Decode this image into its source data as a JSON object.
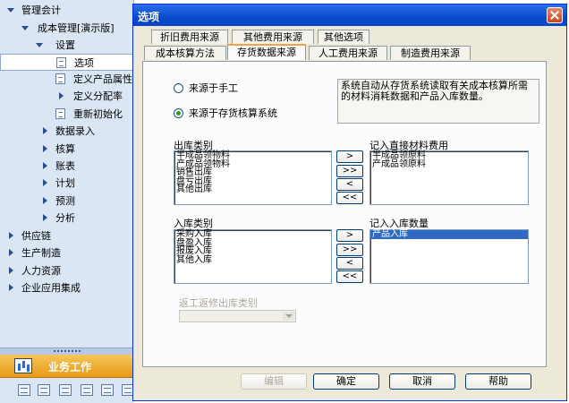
{
  "nav": {
    "items": [
      {
        "label": "管理会计",
        "expander": "down"
      },
      {
        "label": "成本管理[演示版]",
        "expander": "down"
      },
      {
        "label": "设置",
        "expander": "down"
      },
      {
        "label": "选项",
        "icon": "doc-icon",
        "selected": true
      },
      {
        "label": "定义产品属性",
        "icon": "doc-icon"
      },
      {
        "label": "定义分配率",
        "expander": "right"
      },
      {
        "label": "重新初始化",
        "icon": "doc-icon"
      },
      {
        "label": "数据录入",
        "expander": "right"
      },
      {
        "label": "核算",
        "expander": "right"
      },
      {
        "label": "账表",
        "expander": "right"
      },
      {
        "label": "计划",
        "expander": "right"
      },
      {
        "label": "预测",
        "expander": "right"
      },
      {
        "label": "分析",
        "expander": "right"
      },
      {
        "label": "供应链",
        "expander": "right"
      },
      {
        "label": "生产制造",
        "expander": "right"
      },
      {
        "label": "人力资源",
        "expander": "right"
      },
      {
        "label": "企业应用集成",
        "expander": "right"
      }
    ],
    "business_work_label": "业务工作"
  },
  "dialog": {
    "title": "选项",
    "tabs_back": [
      "折旧费用来源",
      "其他费用来源",
      "其他选项"
    ],
    "tabs_front": [
      "成本核算方法",
      "存货数据来源",
      "人工费用来源",
      "制造费用来源"
    ],
    "active_tab": "存货数据来源",
    "radio_manual": "来源于手工",
    "radio_inventory": "来源于存货核算系统",
    "description": "系统自动从存货系统读取有关成本核算所需的材料消耗数据和产品入库数量。",
    "outbound_label": "出库类别",
    "outbound_items": [
      "半成品领物料",
      "产成品领物料",
      "销售出库",
      "盘亏出库",
      "其他出库"
    ],
    "direct_material_label": "记入直接材料费用",
    "direct_material_items": [
      "半成品领原料",
      "产成品领原料"
    ],
    "inbound_label": "入库类别",
    "inbound_items": [
      "采购入库",
      "盘盈入库",
      "报废入库",
      "其他入库"
    ],
    "inbound_qty_label": "记入入库数量",
    "inbound_qty_items": [
      "产品入库"
    ],
    "move_buttons": [
      ">",
      ">>",
      "<",
      "<<"
    ],
    "combo_label": "返工返修出库类别",
    "buttons": {
      "edit": "编辑",
      "ok": "确定",
      "cancel": "取消",
      "help": "帮助"
    }
  }
}
